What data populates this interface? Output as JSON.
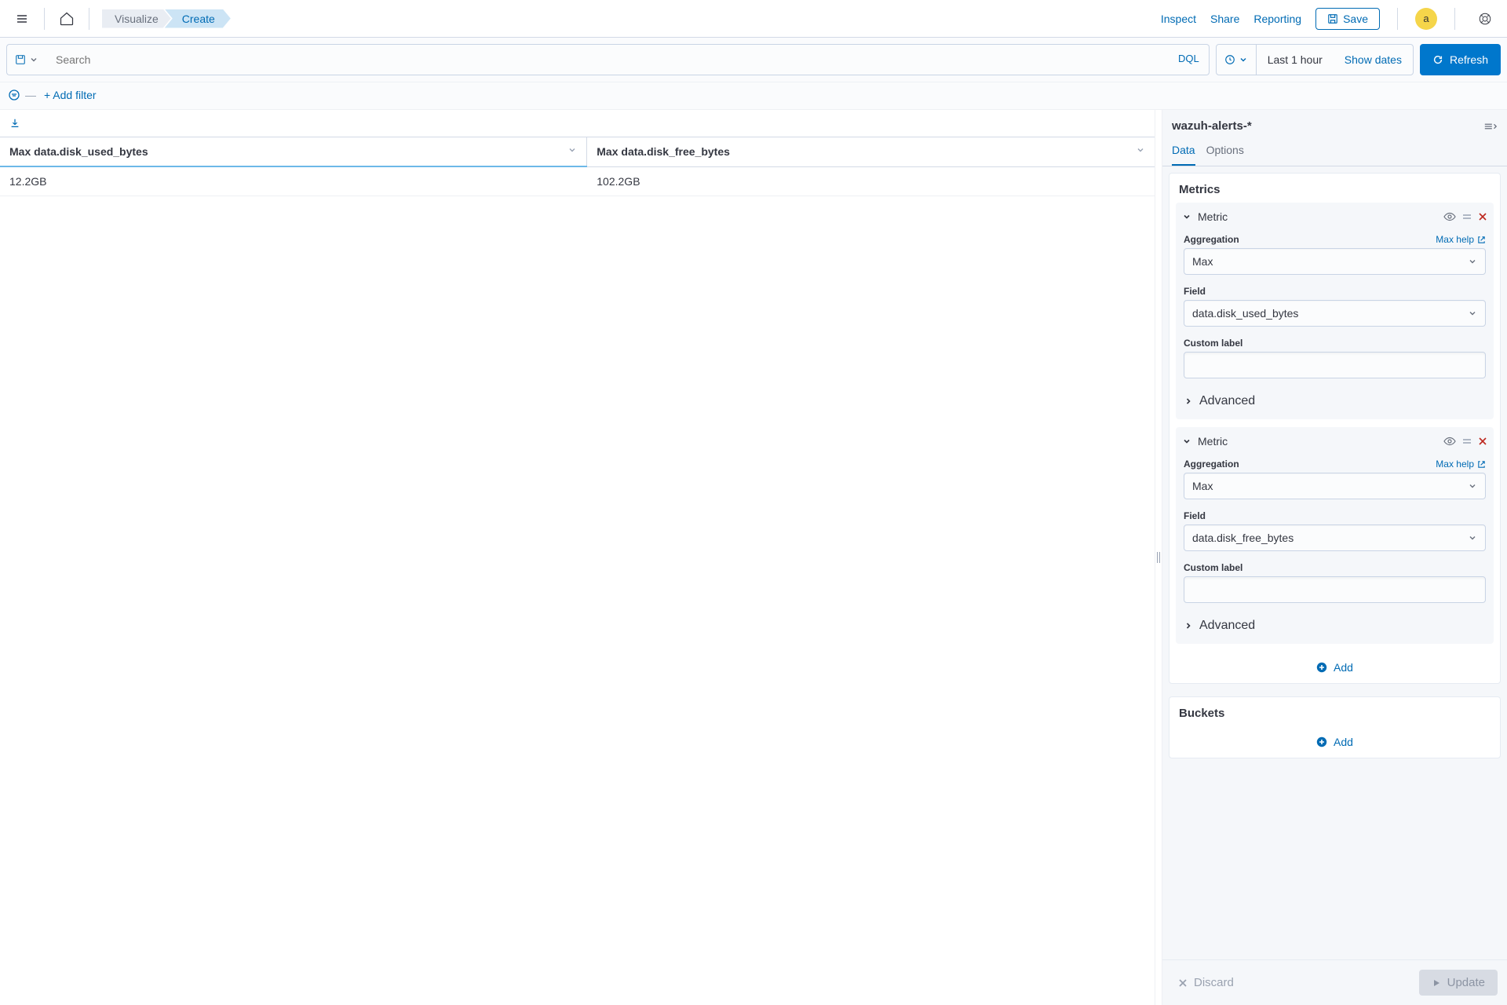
{
  "nav": {
    "breadcrumb_visualize": "Visualize",
    "breadcrumb_create": "Create",
    "inspect": "Inspect",
    "share": "Share",
    "reporting": "Reporting",
    "save": "Save",
    "avatar": "a"
  },
  "query": {
    "search_placeholder": "Search",
    "dql": "DQL",
    "time_range": "Last 1 hour",
    "show_dates": "Show dates",
    "refresh": "Refresh",
    "add_filter": "+ Add filter"
  },
  "table": {
    "columns": [
      "Max data.disk_used_bytes",
      "Max data.disk_free_bytes"
    ],
    "rows": [
      [
        "12.2GB",
        "102.2GB"
      ]
    ]
  },
  "side": {
    "index_pattern": "wazuh-alerts-*",
    "tabs": {
      "data": "Data",
      "options": "Options"
    },
    "metrics_title": "Metrics",
    "buckets_title": "Buckets",
    "add": "Add",
    "advanced": "Advanced",
    "labels": {
      "aggregation": "Aggregation",
      "field": "Field",
      "custom_label": "Custom label",
      "max_help": "Max help"
    },
    "metrics": [
      {
        "title": "Metric",
        "aggregation": "Max",
        "field": "data.disk_used_bytes",
        "custom_label": ""
      },
      {
        "title": "Metric",
        "aggregation": "Max",
        "field": "data.disk_free_bytes",
        "custom_label": ""
      }
    ],
    "footer": {
      "discard": "Discard",
      "update": "Update"
    }
  }
}
